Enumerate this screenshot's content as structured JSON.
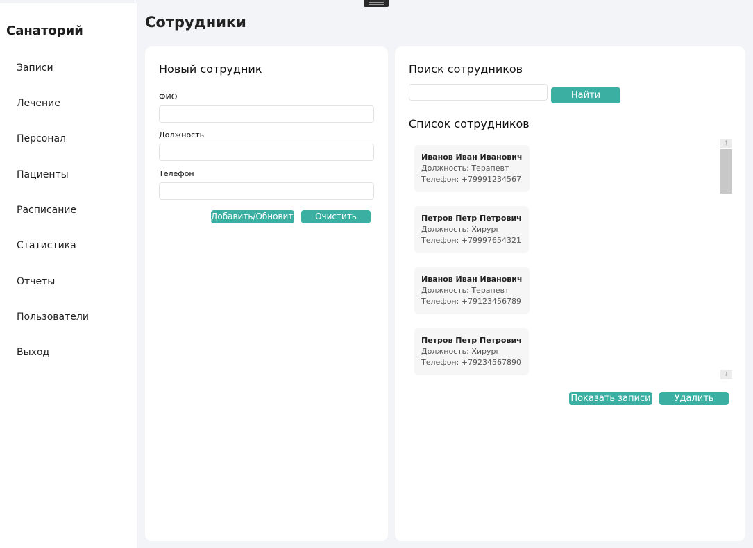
{
  "sidebar": {
    "title": "Санаторий",
    "items": [
      {
        "label": "Записи"
      },
      {
        "label": "Лечение"
      },
      {
        "label": "Персонал"
      },
      {
        "label": "Пациенты"
      },
      {
        "label": "Расписание"
      },
      {
        "label": "Статистика"
      },
      {
        "label": "Отчеты"
      },
      {
        "label": "Пользователи"
      },
      {
        "label": "Выход"
      }
    ]
  },
  "page": {
    "title": "Сотрудники"
  },
  "form": {
    "title": "Новый сотрудник",
    "fields": [
      {
        "label": "ФИО",
        "value": ""
      },
      {
        "label": "Должность",
        "value": ""
      },
      {
        "label": "Телефон",
        "value": ""
      }
    ],
    "add_button": "Добавить/Обновить",
    "clear_button": "Очистить"
  },
  "search": {
    "title": "Поиск сотрудников",
    "value": "",
    "button": "Найти"
  },
  "list": {
    "title": "Список сотрудников",
    "employees": [
      {
        "name": "Иванов Иван Иванович",
        "position": "Должность: Терапевт",
        "phone": "Телефон: +79991234567"
      },
      {
        "name": "Петров Петр Петрович",
        "position": "Должность: Хирург",
        "phone": "Телефон: +79997654321"
      },
      {
        "name": "Иванов Иван Иванович",
        "position": "Должность: Терапевт",
        "phone": "Телефон: +79123456789"
      },
      {
        "name": "Петров Петр Петрович",
        "position": "Должность: Хирург",
        "phone": "Телефон: +79234567890"
      }
    ],
    "show_records_button": "Показать записи",
    "delete_button": "Удалить"
  },
  "colors": {
    "accent": "#3bb0a2",
    "background": "#f3f4f7",
    "card": "#ffffff"
  }
}
